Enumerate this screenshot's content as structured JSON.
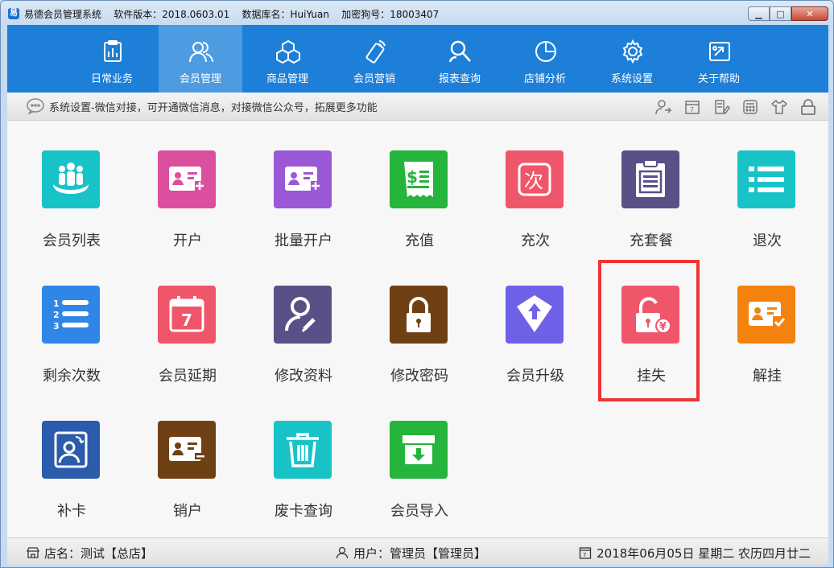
{
  "window": {
    "title": "易德会员管理系统    软件版本：2018.0603.01    数据库名：HuiYuan    加密狗号：18003407",
    "app_icon_letter": "易"
  },
  "nav": {
    "items": [
      {
        "label": "日常业务",
        "icon": "clipboard-chart-icon"
      },
      {
        "label": "会员管理",
        "icon": "users-icon",
        "active": true
      },
      {
        "label": "商品管理",
        "icon": "cubes-icon"
      },
      {
        "label": "会员营销",
        "icon": "phone-tag-icon"
      },
      {
        "label": "报表查询",
        "icon": "search-person-icon"
      },
      {
        "label": "店铺分析",
        "icon": "pie-chart-icon"
      },
      {
        "label": "系统设置",
        "icon": "gear-icon"
      },
      {
        "label": "关于帮助",
        "icon": "help-arrow-icon"
      }
    ]
  },
  "info": {
    "message": "系统设置-微信对接，可开通微信消息，对接微信公众号，拓展更多功能"
  },
  "tiles": [
    {
      "label": "会员列表",
      "color": "#18c3c8"
    },
    {
      "label": "开户",
      "color": "#dc4f9f"
    },
    {
      "label": "批量开户",
      "color": "#9a57d6"
    },
    {
      "label": "充值",
      "color": "#25b43c"
    },
    {
      "label": "充次",
      "color": "#f0566a"
    },
    {
      "label": "充套餐",
      "color": "#5a4f86"
    },
    {
      "label": "退次",
      "color": "#18c3c8"
    },
    {
      "label": "剩余次数",
      "color": "#2f86e6"
    },
    {
      "label": "会员延期",
      "color": "#f0566a"
    },
    {
      "label": "修改资料",
      "color": "#5a4f86"
    },
    {
      "label": "修改密码",
      "color": "#704015"
    },
    {
      "label": "会员升级",
      "color": "#6f60e8"
    },
    {
      "label": "挂失",
      "color": "#f0566a"
    },
    {
      "label": "解挂",
      "color": "#f4820f"
    },
    {
      "label": "补卡",
      "color": "#2b5bab"
    },
    {
      "label": "销户",
      "color": "#704015"
    },
    {
      "label": "废卡查询",
      "color": "#18c3c8"
    },
    {
      "label": "会员导入",
      "color": "#25b43c"
    }
  ],
  "tile_glyphs": {
    "recharge_dollar": "$",
    "recharge_count": "次",
    "calendar_day": "7",
    "yuan": "¥",
    "list_nums": [
      "1",
      "2",
      "3"
    ]
  },
  "status": {
    "store": "店名：测试【总店】",
    "user": "用户：管理员【管理员】",
    "date": "2018年06月05日 星期二 农历四月廿二",
    "calendar_day": "7"
  }
}
